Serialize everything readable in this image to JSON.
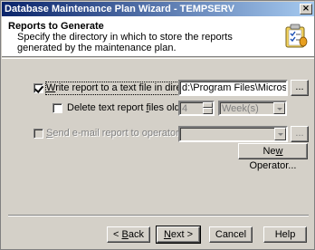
{
  "window": {
    "title": "Database Maintenance Plan Wizard - TEMPSERV",
    "close_label": "×"
  },
  "header": {
    "title": "Reports to Generate",
    "description": "Specify the directory in which to store the reports generated by the maintenance plan."
  },
  "report": {
    "write_label_pre": "",
    "write_label_u": "W",
    "write_label_post": "rite report to a text file in directory:",
    "write_checked": true,
    "directory_value": "d:\\Program Files\\Microsoft SQL Se",
    "browse_label": "...",
    "delete_label_pre": "Delete text report ",
    "delete_label_u": "f",
    "delete_label_post": "iles older than:",
    "delete_checked": false,
    "age_value": "4",
    "unit_value": "Week(s)"
  },
  "email": {
    "label_pre": "",
    "label_u": "S",
    "label_post": "end e-mail report to operator:",
    "checked": false,
    "operator_value": "",
    "browse_label": "...",
    "new_operator_pre": "Ne",
    "new_operator_u": "w",
    "new_operator_post": " Operator..."
  },
  "footer": {
    "back_pre": "< ",
    "back_u": "B",
    "back_post": "ack",
    "next_pre": "",
    "next_u": "N",
    "next_post": "ext >",
    "cancel_label": "Cancel",
    "help_label": "Help"
  }
}
